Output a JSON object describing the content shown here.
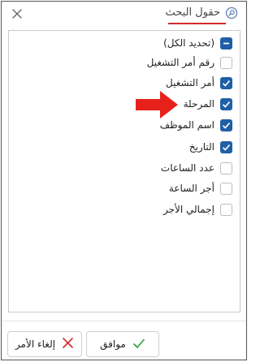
{
  "dialog": {
    "title": "حقول البحث",
    "title_icon": "search-icon",
    "close_icon": "close-icon",
    "accent_color": "#d8282d",
    "checkbox_color": "#1f5fa8"
  },
  "fields": [
    {
      "label": "(تحديد الكل)",
      "state": "partial"
    },
    {
      "label": "رقم أمر التشغيل",
      "state": "unchecked"
    },
    {
      "label": "أمر التشغيل",
      "state": "checked"
    },
    {
      "label": "المرحلة",
      "state": "checked"
    },
    {
      "label": "اسم الموظف",
      "state": "checked"
    },
    {
      "label": "التاريخ",
      "state": "checked"
    },
    {
      "label": "عدد الساعات",
      "state": "unchecked"
    },
    {
      "label": "أجر الساعة",
      "state": "unchecked"
    },
    {
      "label": "إجمالي الأجر",
      "state": "unchecked"
    }
  ],
  "annotation": {
    "icon": "red-arrow-icon",
    "color": "#e8201c"
  },
  "buttons": {
    "ok_label": "موافق",
    "ok_icon": "check-icon",
    "ok_icon_color": "#2e9e3e",
    "cancel_label": "إلغاء الأمر",
    "cancel_icon": "cross-icon",
    "cancel_icon_color": "#d8282d"
  }
}
